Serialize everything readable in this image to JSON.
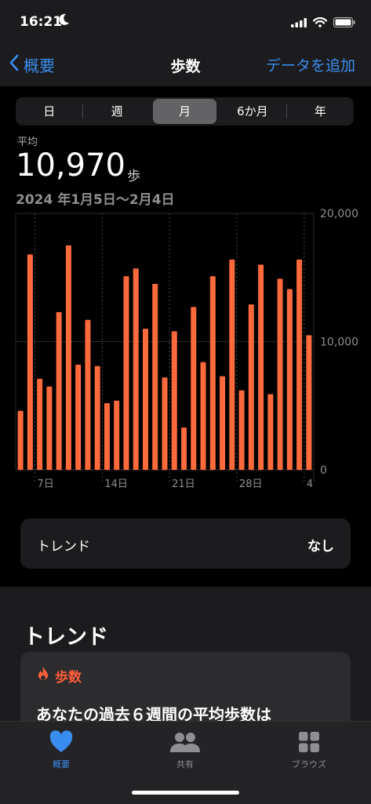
{
  "status": {
    "time": "16:21"
  },
  "nav": {
    "back_label": "概要",
    "title": "歩数",
    "add_label": "データを追加"
  },
  "segments": [
    "日",
    "週",
    "月",
    "6か月",
    "年"
  ],
  "selected_segment": "月",
  "summary": {
    "label": "平均",
    "value": "10,970",
    "unit": "歩",
    "range": "2024 年1月5日〜2月4日"
  },
  "chart_data": {
    "type": "bar",
    "color": "#ff6a3c",
    "categories": [
      "1/5",
      "1/6",
      "1/7",
      "1/8",
      "1/9",
      "1/10",
      "1/11",
      "1/12",
      "1/13",
      "1/14",
      "1/15",
      "1/16",
      "1/17",
      "1/18",
      "1/19",
      "1/20",
      "1/21",
      "1/22",
      "1/23",
      "1/24",
      "1/25",
      "1/26",
      "1/27",
      "1/28",
      "1/29",
      "1/30",
      "1/31",
      "2/1",
      "2/2",
      "2/3",
      "2/4"
    ],
    "values": [
      4600,
      16800,
      7100,
      6500,
      12300,
      17500,
      8200,
      11700,
      8100,
      5200,
      5400,
      15100,
      15700,
      11000,
      14500,
      7200,
      10800,
      3300,
      12700,
      8400,
      15100,
      7300,
      16400,
      6200,
      12900,
      16000,
      5900,
      14900,
      14100,
      16400,
      10500
    ],
    "x_tick_labels": [
      "7日",
      "14日",
      "21日",
      "28日",
      "4"
    ],
    "y_tick_labels": [
      "20,000",
      "10,000",
      "0"
    ],
    "ylim": [
      0,
      20000
    ],
    "grid": true
  },
  "trend_row": {
    "label": "トレンド",
    "value": "なし"
  },
  "trend_section": {
    "title": "トレンド",
    "card_label": "歩数",
    "card_text": "あなたの過去６週間の平均歩数は"
  },
  "tabs": [
    {
      "label": "概要",
      "icon": "heart-icon",
      "active": true
    },
    {
      "label": "共有",
      "icon": "people-icon",
      "active": false
    },
    {
      "label": "ブラウズ",
      "icon": "grid-icon",
      "active": false
    }
  ],
  "colors": {
    "accent": "#3a8df0",
    "steps": "#ff6a3c",
    "background": "#000000",
    "card": "#1c1c1e"
  }
}
